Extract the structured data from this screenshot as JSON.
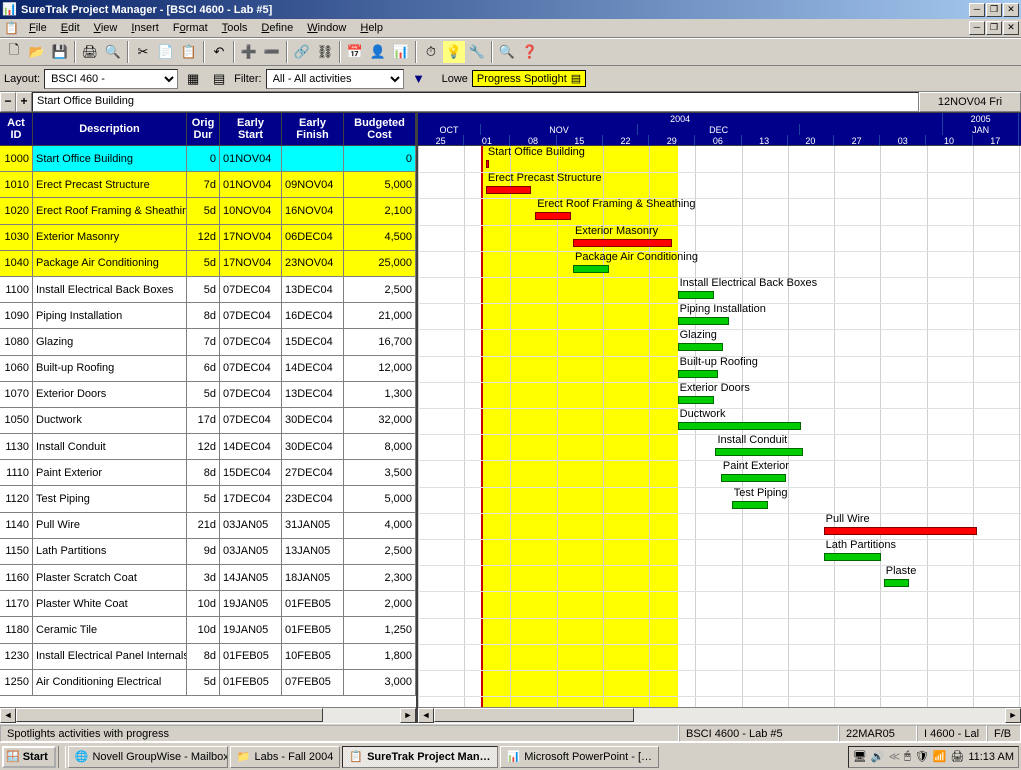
{
  "window": {
    "title": "SureTrak Project Manager - [BSCI 4600 - Lab #5]",
    "date_display": "12NOV04 Fri"
  },
  "menu": {
    "items": [
      "File",
      "Edit",
      "View",
      "Insert",
      "Format",
      "Tools",
      "Define",
      "Window",
      "Help"
    ]
  },
  "layout_bar": {
    "layout_label": "Layout:",
    "layout_value": "BSCI 460 -",
    "filter_label": "Filter:",
    "filter_value": "All - All activities",
    "lower_label": "Lowe",
    "spotlight_label": "Progress Spotlight"
  },
  "activity_input": {
    "value": "Start Office Building"
  },
  "columns": {
    "act_id": "Act\nID",
    "description": "Description",
    "orig_dur": "Orig\nDur",
    "early_start": "Early\nStart",
    "early_finish": "Early\nFinish",
    "budgeted_cost": "Budgeted\nCost"
  },
  "rows": [
    {
      "id": "1000",
      "desc": "Start Office Building",
      "dur": "0",
      "es": "01NOV04",
      "ef": "",
      "bc": "0",
      "hl": "cyan",
      "bar": {
        "start": 0.113,
        "len": 0.005,
        "color": "red"
      }
    },
    {
      "id": "1010",
      "desc": "Erect Precast Structure",
      "dur": "7d",
      "es": "01NOV04",
      "ef": "09NOV04",
      "bc": "5,000",
      "hl": "yellow",
      "bar": {
        "start": 0.113,
        "len": 0.075,
        "color": "red"
      }
    },
    {
      "id": "1020",
      "desc": "Erect Roof Framing & Sheathing",
      "dur": "5d",
      "es": "10NOV04",
      "ef": "16NOV04",
      "bc": "2,100",
      "hl": "yellow",
      "bar": {
        "start": 0.195,
        "len": 0.06,
        "color": "red"
      }
    },
    {
      "id": "1030",
      "desc": "Exterior Masonry",
      "dur": "12d",
      "es": "17NOV04",
      "ef": "06DEC04",
      "bc": "4,500",
      "hl": "yellow",
      "bar": {
        "start": 0.258,
        "len": 0.165,
        "color": "red"
      }
    },
    {
      "id": "1040",
      "desc": "Package Air Conditioning",
      "dur": "5d",
      "es": "17NOV04",
      "ef": "23NOV04",
      "bc": "25,000",
      "hl": "yellow",
      "bar": {
        "start": 0.258,
        "len": 0.06,
        "color": "green"
      }
    },
    {
      "id": "1100",
      "desc": "Install Electrical Back Boxes",
      "dur": "5d",
      "es": "07DEC04",
      "ef": "13DEC04",
      "bc": "2,500",
      "hl": "",
      "bar": {
        "start": 0.432,
        "len": 0.06,
        "color": "green"
      }
    },
    {
      "id": "1090",
      "desc": "Piping Installation",
      "dur": "8d",
      "es": "07DEC04",
      "ef": "16DEC04",
      "bc": "21,000",
      "hl": "",
      "bar": {
        "start": 0.432,
        "len": 0.085,
        "color": "green"
      }
    },
    {
      "id": "1080",
      "desc": "Glazing",
      "dur": "7d",
      "es": "07DEC04",
      "ef": "15DEC04",
      "bc": "16,700",
      "hl": "",
      "bar": {
        "start": 0.432,
        "len": 0.075,
        "color": "green"
      }
    },
    {
      "id": "1060",
      "desc": "Built-up Roofing",
      "dur": "6d",
      "es": "07DEC04",
      "ef": "14DEC04",
      "bc": "12,000",
      "hl": "",
      "bar": {
        "start": 0.432,
        "len": 0.068,
        "color": "green"
      }
    },
    {
      "id": "1070",
      "desc": "Exterior Doors",
      "dur": "5d",
      "es": "07DEC04",
      "ef": "13DEC04",
      "bc": "1,300",
      "hl": "",
      "bar": {
        "start": 0.432,
        "len": 0.06,
        "color": "green"
      }
    },
    {
      "id": "1050",
      "desc": "Ductwork",
      "dur": "17d",
      "es": "07DEC04",
      "ef": "30DEC04",
      "bc": "32,000",
      "hl": "",
      "bar": {
        "start": 0.432,
        "len": 0.205,
        "color": "green"
      }
    },
    {
      "id": "1130",
      "desc": "Install Conduit",
      "dur": "12d",
      "es": "14DEC04",
      "ef": "30DEC04",
      "bc": "8,000",
      "hl": "",
      "bar": {
        "start": 0.495,
        "len": 0.145,
        "color": "green"
      }
    },
    {
      "id": "1110",
      "desc": "Paint Exterior",
      "dur": "8d",
      "es": "15DEC04",
      "ef": "27DEC04",
      "bc": "3,500",
      "hl": "",
      "bar": {
        "start": 0.504,
        "len": 0.108,
        "color": "green"
      }
    },
    {
      "id": "1120",
      "desc": "Test Piping",
      "dur": "5d",
      "es": "17DEC04",
      "ef": "23DEC04",
      "bc": "5,000",
      "hl": "",
      "bar": {
        "start": 0.522,
        "len": 0.06,
        "color": "green"
      }
    },
    {
      "id": "1140",
      "desc": "Pull Wire",
      "dur": "21d",
      "es": "03JAN05",
      "ef": "31JAN05",
      "bc": "4,000",
      "hl": "",
      "bar": {
        "start": 0.675,
        "len": 0.255,
        "color": "red"
      }
    },
    {
      "id": "1150",
      "desc": "Lath Partitions",
      "dur": "9d",
      "es": "03JAN05",
      "ef": "13JAN05",
      "bc": "2,500",
      "hl": "",
      "bar": {
        "start": 0.675,
        "len": 0.095,
        "color": "green"
      }
    },
    {
      "id": "1160",
      "desc": "Plaster Scratch Coat",
      "dur": "3d",
      "es": "14JAN05",
      "ef": "18JAN05",
      "bc": "2,300",
      "hl": "",
      "bar": {
        "start": 0.775,
        "len": 0.042,
        "color": "green",
        "label": "Plaste"
      }
    },
    {
      "id": "1170",
      "desc": "Plaster White Coat",
      "dur": "10d",
      "es": "19JAN05",
      "ef": "01FEB05",
      "bc": "2,000",
      "hl": "",
      "bar": null
    },
    {
      "id": "1180",
      "desc": "Ceramic Tile",
      "dur": "10d",
      "es": "19JAN05",
      "ef": "01FEB05",
      "bc": "1,250",
      "hl": "",
      "bar": null
    },
    {
      "id": "1230",
      "desc": "Install Electrical Panel Internals",
      "dur": "8d",
      "es": "01FEB05",
      "ef": "10FEB05",
      "bc": "1,800",
      "hl": "",
      "bar": null
    },
    {
      "id": "1250",
      "desc": "Air Conditioning Electrical",
      "dur": "5d",
      "es": "01FEB05",
      "ef": "07FEB05",
      "bc": "3,000",
      "hl": "",
      "bar": null
    }
  ],
  "timeline": {
    "years": [
      {
        "label": "2004",
        "span": 0.874
      },
      {
        "label": "2005",
        "span": 0.126
      }
    ],
    "months": [
      {
        "label": "OCT",
        "span": 0.105
      },
      {
        "label": "NOV",
        "span": 0.261
      },
      {
        "label": "DEC",
        "span": 0.27
      },
      {
        "label": "",
        "span": 0.238
      },
      {
        "label": "JAN",
        "span": 0.126
      }
    ],
    "days": [
      "25",
      "01",
      "08",
      "15",
      "22",
      "29",
      "06",
      "13",
      "20",
      "27",
      "03",
      "10",
      "17"
    ],
    "spotlight_start": 0.105,
    "spotlight_end": 0.432,
    "dataline": 0.105
  },
  "status": {
    "hint": "Spotlights activities with progress",
    "project": "BSCI 4600 - Lab #5",
    "date": "22MAR05",
    "slot3": "I 4600 - Lal",
    "slot4": "F/B"
  },
  "taskbar": {
    "start": "Start",
    "tasks": [
      {
        "label": "Novell GroupWise - Mailbox",
        "active": false,
        "icon": "globe"
      },
      {
        "label": "Labs - Fall 2004",
        "active": false,
        "icon": "folder"
      },
      {
        "label": "SureTrak Project Man…",
        "active": true,
        "icon": "app"
      },
      {
        "label": "Microsoft PowerPoint - […",
        "active": false,
        "icon": "ppt"
      }
    ],
    "clock": "11:13 AM"
  }
}
